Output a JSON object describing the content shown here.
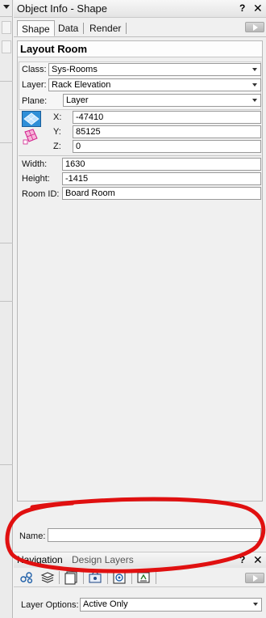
{
  "window": {
    "title": "Object Info - Shape",
    "help_glyph": "?",
    "close_glyph": "✕"
  },
  "tabs": [
    {
      "label": "Shape",
      "active": true
    },
    {
      "label": "Data",
      "active": false
    },
    {
      "label": "Render",
      "active": false
    }
  ],
  "shape_name": "Layout Room",
  "fields": {
    "class": {
      "label": "Class:",
      "value": "Sys-Rooms"
    },
    "layer": {
      "label": "Layer:",
      "value": "Rack Elevation"
    },
    "plane": {
      "label": "Plane:",
      "value": "Layer"
    },
    "x": {
      "label": "X:",
      "value": "-47410"
    },
    "y": {
      "label": "Y:",
      "value": "85125"
    },
    "z": {
      "label": "Z:",
      "value": "0"
    },
    "width": {
      "label": "Width:",
      "value": "1630"
    },
    "height": {
      "label": "Height:",
      "value": "-1415"
    },
    "room_id": {
      "label": "Room ID:",
      "value": "Board Room"
    }
  },
  "name_field": {
    "label": "Name:",
    "value": ""
  },
  "navigation": {
    "title": "Navigation",
    "subtitle": "Design Layers",
    "help_glyph": "?",
    "close_glyph": "✕",
    "tools": [
      "classes-icon",
      "layers-icon",
      "sheet-layers-icon",
      "viewports-icon",
      "saved-views-icon",
      "references-icon"
    ],
    "layer_options": {
      "label": "Layer Options:",
      "value": "Active Only"
    }
  },
  "colors": {
    "annotation": "#e01010",
    "accent_blue": "#2f8fd8",
    "accent_pink": "#d21e8c"
  }
}
